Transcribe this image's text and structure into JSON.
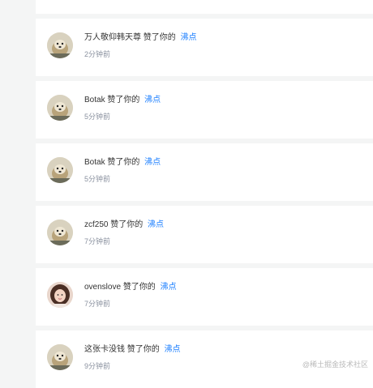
{
  "notifications": [
    {
      "user": "万人敬仰韩天尊",
      "action": "赞了你的",
      "target": "沸点",
      "time": "2分钟前",
      "avatar": "dog-avatar"
    },
    {
      "user": "Botak",
      "action": "赞了你的",
      "target": "沸点",
      "time": "5分钟前",
      "avatar": "dog-avatar"
    },
    {
      "user": "Botak",
      "action": "赞了你的",
      "target": "沸点",
      "time": "5分钟前",
      "avatar": "dog-avatar"
    },
    {
      "user": "zcf250",
      "action": "赞了你的",
      "target": "沸点",
      "time": "7分钟前",
      "avatar": "dog-avatar"
    },
    {
      "user": "ovenslove",
      "action": "赞了你的",
      "target": "沸点",
      "time": "7分钟前",
      "avatar": "girl-avatar"
    },
    {
      "user": "这张卡没钱",
      "action": "赞了你的",
      "target": "沸点",
      "time": "9分钟前",
      "avatar": "dog-avatar"
    }
  ],
  "watermark": "@稀土掘金技术社区",
  "colors": {
    "link": "#1e80ff",
    "background": "#f4f5f5",
    "card": "#ffffff",
    "muted": "#8a919f"
  }
}
